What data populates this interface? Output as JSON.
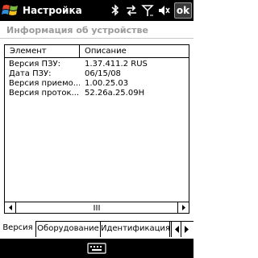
{
  "titlebar": {
    "title": "Настройка",
    "ok_label": "ok",
    "icons": [
      "windows-start-icon",
      "bluetooth-icon",
      "network-icon",
      "signal-icon",
      "volume-off-icon"
    ]
  },
  "header": {
    "title": "Информация об устройстве"
  },
  "listview": {
    "columns": [
      "Элемент",
      "Описание"
    ],
    "rows": [
      {
        "element": "Версия ПЗУ:",
        "description": "1.37.411.2 RUS"
      },
      {
        "element": "Дата ПЗУ:",
        "description": "06/15/08"
      },
      {
        "element": "Версия приемо...",
        "description": "1.00.25.03"
      },
      {
        "element": "Версия проток...",
        "description": "52.26a.25.09H"
      }
    ]
  },
  "tabs": [
    {
      "label": "Версия",
      "active": true
    },
    {
      "label": "Оборудование",
      "active": false
    },
    {
      "label": "Идентификация",
      "active": false
    }
  ],
  "menubar": {
    "icons": [
      "keyboard-icon"
    ]
  }
}
